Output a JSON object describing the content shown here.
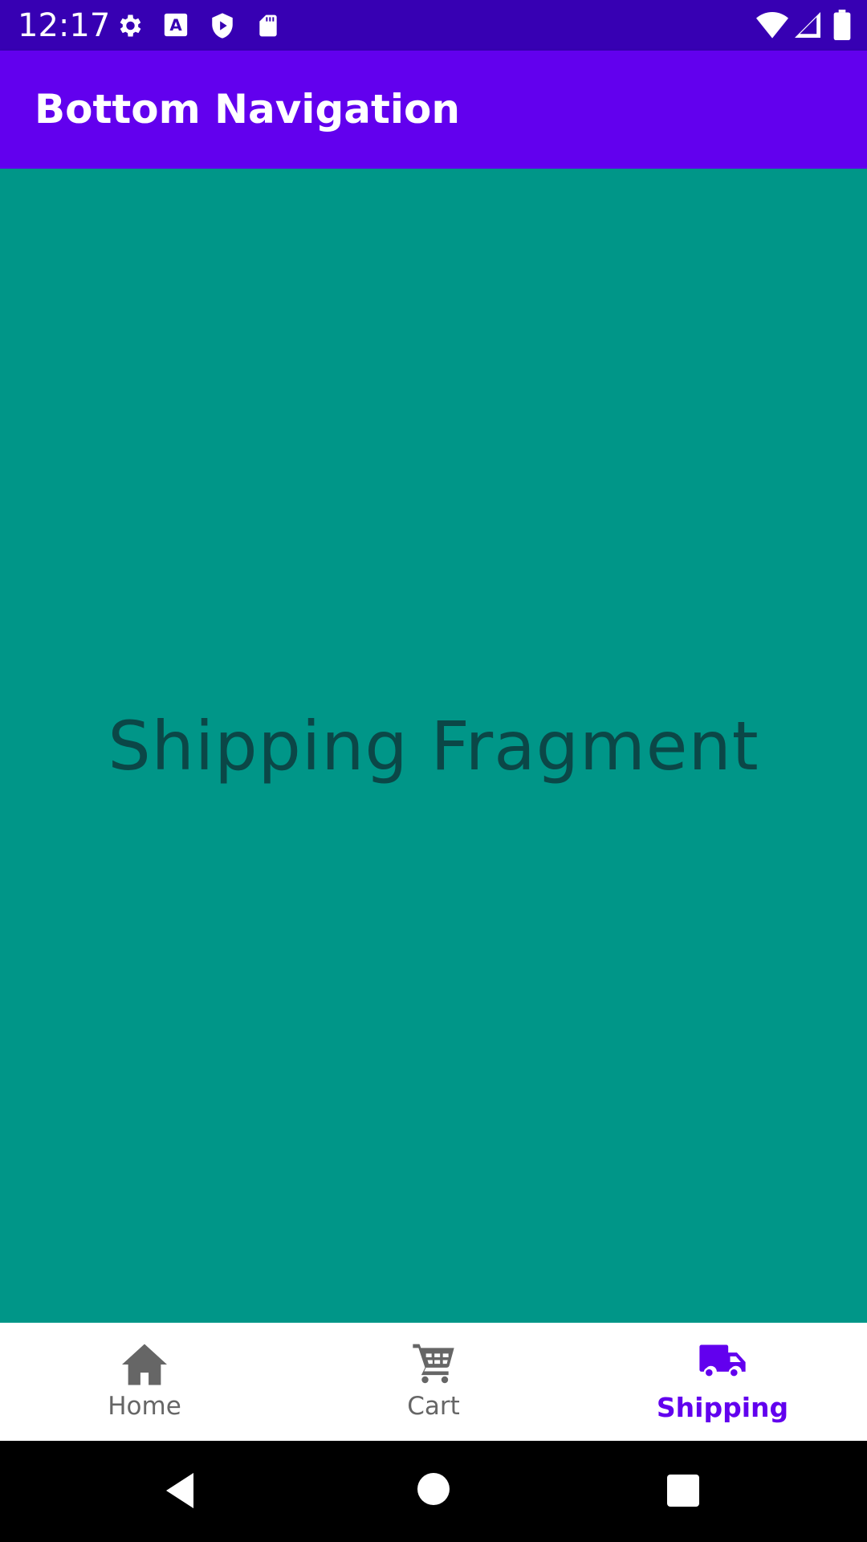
{
  "status_bar": {
    "time": "12:17",
    "icons": [
      "gear-icon",
      "font-a-icon",
      "shield-play-icon",
      "sd-card-icon",
      "wifi-icon",
      "signal-icon",
      "battery-icon"
    ]
  },
  "app_bar": {
    "title": "Bottom Navigation"
  },
  "content": {
    "text": "Shipping Fragment",
    "background": "#009688"
  },
  "bottom_nav": {
    "items": [
      {
        "label": "Home",
        "icon": "home-icon",
        "active": false
      },
      {
        "label": "Cart",
        "icon": "cart-icon",
        "active": false
      },
      {
        "label": "Shipping",
        "icon": "truck-icon",
        "active": true
      }
    ],
    "active_color": "#6200ee",
    "inactive_color": "#666666"
  },
  "system_nav": {
    "buttons": [
      "back-icon",
      "home-circle-icon",
      "recents-icon"
    ]
  },
  "colors": {
    "status_bar": "#3700b3",
    "app_bar": "#6200ee"
  }
}
